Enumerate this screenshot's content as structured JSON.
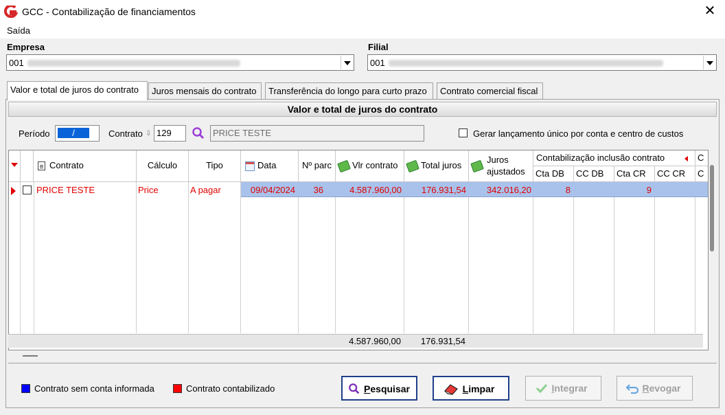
{
  "window": {
    "title": "GCC - Contabilização de financiamentos",
    "close": "✕"
  },
  "menu": {
    "items": [
      "Saída"
    ]
  },
  "empresa": {
    "label": "Empresa",
    "value": "001"
  },
  "filial": {
    "label": "Filial",
    "value": "001"
  },
  "tabs": [
    {
      "label": "Valor e total de juros do contrato"
    },
    {
      "label": "Juros mensais do contrato"
    },
    {
      "label": "Transferência do longo para curto prazo"
    },
    {
      "label": "Contrato comercial fiscal"
    }
  ],
  "section": {
    "title": "Valor e total de juros do contrato"
  },
  "filters": {
    "periodo_label": "Período",
    "periodo_value": "/",
    "contrato_label": "Contrato",
    "contrato_value": "129",
    "contrato_desc": "PRICE TESTE",
    "gerar_label": "Gerar lançamento único por conta e centro de custos"
  },
  "grid": {
    "headers": {
      "contrato": "Contrato",
      "calculo": "Cálculo",
      "tipo": "Tipo",
      "data": "Data",
      "nparc": "Nº parc",
      "vlr_contrato": "Vlr contrato",
      "total_juros": "Total juros",
      "juros_ajustados_1": "Juros",
      "juros_ajustados_2": "ajustados",
      "group_inclusao": "Contabilização inclusão contrato",
      "cta_db": "Cta DB",
      "cc_db": "CC DB",
      "cta_cr": "Cta CR",
      "cc_cr": "CC CR",
      "group_next": "C",
      "next_sub": "C"
    },
    "rows": [
      {
        "contrato": "PRICE TESTE",
        "calculo": "Price",
        "tipo": "A pagar",
        "data": "09/04/2024",
        "nparc": "36",
        "vlr_contrato": "4.587.960,00",
        "total_juros": "176.931,54",
        "juros_ajustados": "342.016,20",
        "cta_db": "8",
        "cc_db": "",
        "cta_cr": "9",
        "cc_cr": ""
      }
    ],
    "totals": {
      "vlr_contrato": "4.587.960,00",
      "total_juros": "176.931,54"
    }
  },
  "legend": [
    {
      "label": "Contrato sem conta informada",
      "color": "#0000ff"
    },
    {
      "label": "Contrato contabilizado",
      "color": "#ff0000"
    }
  ],
  "buttons": {
    "pesquisar_u": "P",
    "pesquisar_rest": "esquisar",
    "limpar_u": "L",
    "limpar_rest": "impar",
    "integrar_u": "I",
    "integrar_rest": "ntegrar",
    "revogar_u": "R",
    "revogar_rest": "evogar"
  },
  "colors": {
    "selected_row": "#a9c2eb",
    "accent": "#1e3f8a",
    "error": "#e00000"
  }
}
